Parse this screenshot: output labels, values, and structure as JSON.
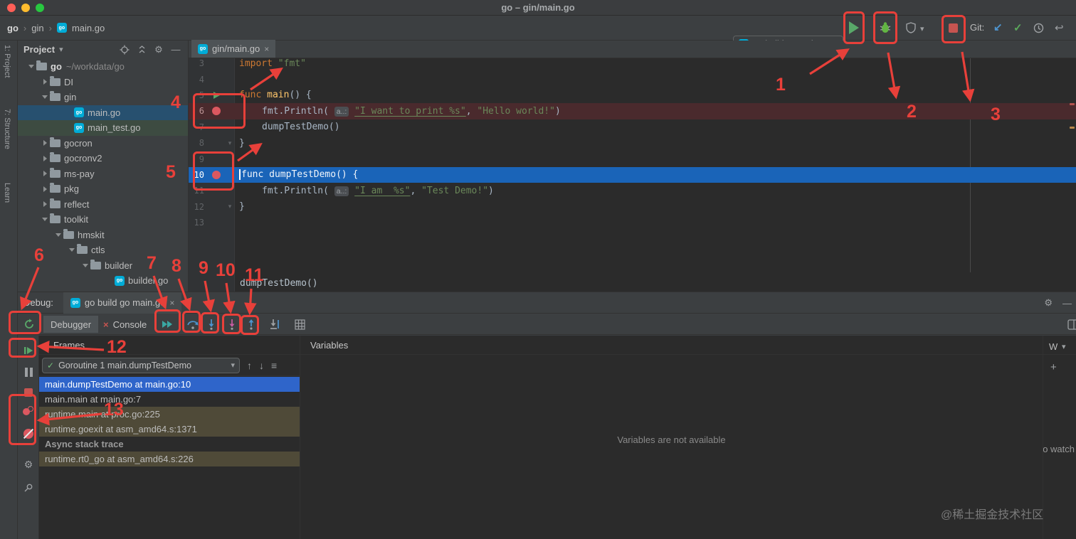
{
  "titlebar": {
    "title": "go – gin/main.go"
  },
  "topbar": {
    "breadcrumbs": [
      "go",
      "gin",
      "main.go"
    ],
    "run_config": "go build go main.go",
    "git_label": "Git:"
  },
  "tool_strip": {
    "labels": [
      "1: Project",
      "7: Structure",
      "Learn"
    ]
  },
  "icons": {
    "caret_down": "▾",
    "crumb_sep": "›",
    "close": "×",
    "settings": "⚙",
    "minimize": "—",
    "commit": "✓",
    "update": "↙",
    "rollback": "↩",
    "up": "↑",
    "down": "↓",
    "menu": "≡",
    "add": "+",
    "check": "✓",
    "fold": "▾",
    "go_badge": "go",
    "console_x": "×"
  },
  "project": {
    "title": "Project",
    "tree": [
      {
        "label": "go",
        "hint": "~/workdata/go",
        "level": 0,
        "type": "folder",
        "state": "expanded",
        "bold": true
      },
      {
        "label": "DI",
        "level": 1,
        "type": "folder",
        "state": "collapsed"
      },
      {
        "label": "gin",
        "level": 1,
        "type": "folder",
        "state": "expanded"
      },
      {
        "label": "main.go",
        "level": 2,
        "type": "file",
        "sel": "primary"
      },
      {
        "label": "main_test.go",
        "level": 2,
        "type": "file",
        "sel": "secondary"
      },
      {
        "label": "gocron",
        "level": 1,
        "type": "folder",
        "state": "collapsed"
      },
      {
        "label": "gocronv2",
        "level": 1,
        "type": "folder",
        "state": "collapsed"
      },
      {
        "label": "ms-pay",
        "level": 1,
        "type": "folder",
        "state": "collapsed"
      },
      {
        "label": "pkg",
        "level": 1,
        "type": "folder",
        "state": "collapsed"
      },
      {
        "label": "reflect",
        "level": 1,
        "type": "folder",
        "state": "collapsed"
      },
      {
        "label": "toolkit",
        "level": 1,
        "type": "folder",
        "state": "expanded"
      },
      {
        "label": "hmskit",
        "level": 2,
        "type": "folder",
        "state": "expanded"
      },
      {
        "label": "ctls",
        "level": 3,
        "type": "folder",
        "state": "expanded"
      },
      {
        "label": "builder",
        "level": 4,
        "type": "folder",
        "state": "expanded"
      },
      {
        "label": "builder.go",
        "level": 5,
        "type": "file"
      }
    ]
  },
  "editor": {
    "tab": "gin/main.go",
    "overlay_text": "dumpTestDemo()",
    "lines": [
      {
        "n": "3",
        "tokens": [
          [
            "kw",
            "import"
          ],
          [
            "pl",
            " "
          ],
          [
            "str",
            "\"fmt\""
          ]
        ]
      },
      {
        "n": "4",
        "tokens": []
      },
      {
        "n": "5",
        "gutter": "run",
        "tokens": [
          [
            "kw",
            "func"
          ],
          [
            "pl",
            " "
          ],
          [
            "fn",
            "main"
          ],
          [
            "pl",
            "() {"
          ]
        ]
      },
      {
        "n": "6",
        "bg": "bp",
        "gutter": "bp",
        "ind": 1,
        "tokens": [
          [
            "pl",
            "fmt.Println( "
          ],
          [
            "hint",
            "a..:"
          ],
          [
            "pl",
            " "
          ],
          [
            "stru",
            "\"I want to print %s\""
          ],
          [
            "pl",
            ", "
          ],
          [
            "str",
            "\"Hello world!\""
          ],
          [
            "pl",
            ")"
          ]
        ]
      },
      {
        "n": "7",
        "ind": 1,
        "tokens": [
          [
            "pl",
            "dumpTestDemo()"
          ]
        ]
      },
      {
        "n": "8",
        "fold": true,
        "tokens": [
          [
            "pl",
            "}"
          ]
        ]
      },
      {
        "n": "9",
        "tokens": []
      },
      {
        "n": "10",
        "bg": "exec",
        "gutter": "bp",
        "caret": true,
        "tokens": [
          [
            "kw",
            "func"
          ],
          [
            "pl",
            " "
          ],
          [
            "fn",
            "dumpTestDemo"
          ],
          [
            "pl",
            "() {"
          ]
        ]
      },
      {
        "n": "11",
        "ind": 1,
        "tokens": [
          [
            "pl",
            "fmt.Println( "
          ],
          [
            "hint",
            "a..:"
          ],
          [
            "pl",
            " "
          ],
          [
            "stru",
            "\"I am  %s\""
          ],
          [
            "pl",
            ", "
          ],
          [
            "str",
            "\"Test Demo!\""
          ],
          [
            "pl",
            ")"
          ]
        ]
      },
      {
        "n": "12",
        "fold": true,
        "tokens": [
          [
            "pl",
            "}"
          ]
        ]
      },
      {
        "n": "13",
        "tokens": []
      }
    ]
  },
  "debug": {
    "label": "Debug:",
    "session_tab": "go build go main.go",
    "tab_debugger": "Debugger",
    "tab_console": "Console",
    "frames": {
      "title": "Frames",
      "thread_selector": "Goroutine 1 main.dumpTestDemo",
      "rows": [
        {
          "text": "main.dumpTestDemo at main.go:10",
          "style": "selected"
        },
        {
          "text": "main.main at main.go:7",
          "style": "plain"
        },
        {
          "text": "runtime.main at proc.go:225",
          "style": "library"
        },
        {
          "text": "runtime.goexit at asm_amd64.s:1371",
          "style": "library"
        },
        {
          "text": "Async stack trace",
          "style": "section"
        },
        {
          "text": "runtime.rt0_go at asm_amd64.s:226",
          "style": "library"
        }
      ]
    },
    "variables": {
      "title": "Variables",
      "empty_message": "Variables are not available",
      "watches_label": "W",
      "watch_hint": "o watch"
    }
  },
  "annotations": {
    "labels": [
      "1",
      "2",
      "3",
      "4",
      "5",
      "6",
      "7",
      "8",
      "9",
      "10",
      "11",
      "12",
      "13"
    ]
  },
  "watermark": "@稀土掘金技术社区"
}
